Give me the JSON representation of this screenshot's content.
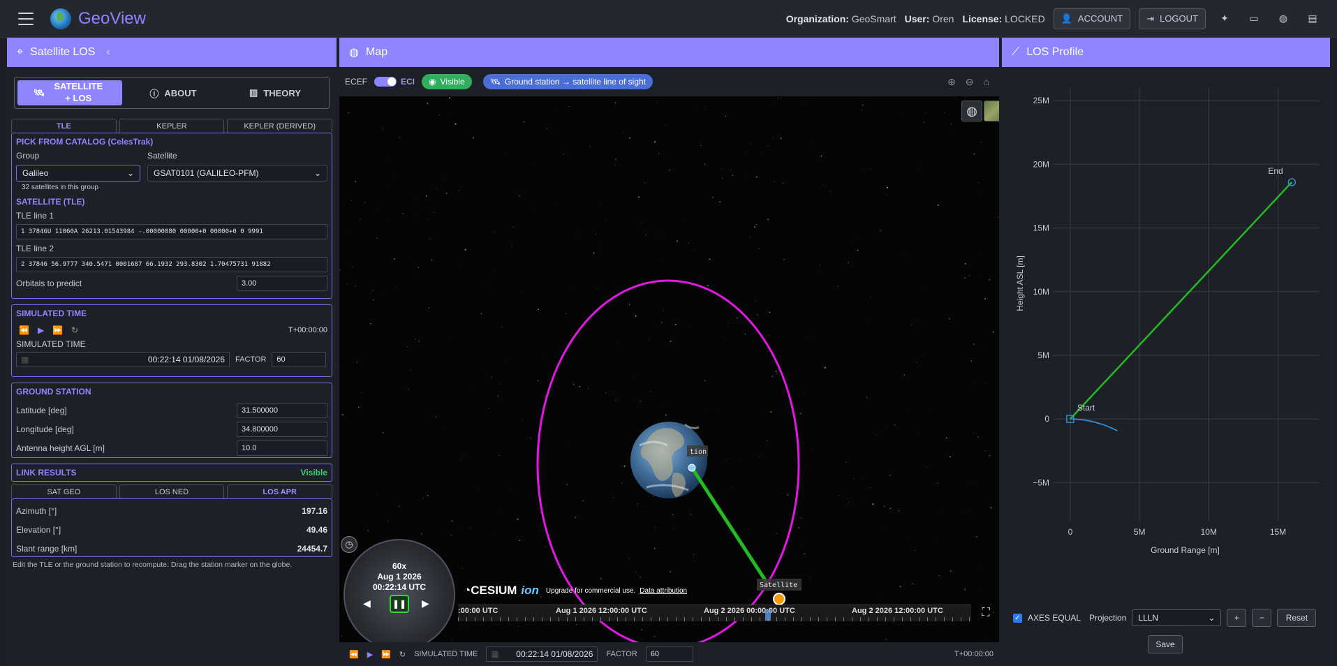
{
  "app": {
    "name": "GeoView",
    "organization_label": "Organization:",
    "organization": "GeoSmart",
    "user_label": "User:",
    "user": "Oren",
    "license_label": "License:",
    "license": "LOCKED",
    "account": "ACCOUNT",
    "logout": "LOGOUT"
  },
  "left": {
    "title": "Satellite LOS",
    "tabs": [
      {
        "label": "SATELLITE + LOS"
      },
      {
        "label": "ABOUT"
      },
      {
        "label": "THEORY"
      }
    ],
    "tle_tabs": [
      "TLE",
      "KEPLER",
      "KEPLER (DERIVED)"
    ],
    "catalog": {
      "title": "PICK FROM CATALOG (CelesTrak)",
      "group_label": "Group",
      "group": "Galileo",
      "satellite_label": "Satellite",
      "satellite": "GSAT0101 (GALILEO-PFM)",
      "group_count": "32 satellites in this group"
    },
    "tle": {
      "title": "SATELLITE (TLE)",
      "line1_label": "TLE line 1",
      "line1": "1 37846U 11060A   26213.01543984 -.00000080  00000+0  00000+0 0  9991",
      "line2_label": "TLE line 2",
      "line2": "2 37846  56.9777 340.5471 0001687  66.1932 293.8302  1.70475731 91882",
      "orbitals_label": "Orbitals to predict",
      "orbitals": "3.00"
    },
    "sim": {
      "title": "SIMULATED TIME",
      "offset": "T+00:00:00",
      "time_label": "SIMULATED TIME",
      "time": "00:22:14 01/08/2026",
      "factor_label": "FACTOR",
      "factor": "60"
    },
    "ground": {
      "title": "GROUND STATION",
      "lat_label": "Latitude [deg]",
      "lat": "31.500000",
      "lon_label": "Longitude [deg]",
      "lon": "34.800000",
      "ant_label": "Antenna height AGL [m]",
      "ant": "10.0"
    },
    "link": {
      "title": "LINK RESULTS",
      "status": "Visible",
      "tabs": [
        "SAT GEO",
        "LOS NED",
        "LOS APR"
      ],
      "az_label": "Azimuth [°]",
      "az": "197.16",
      "el_label": "Elevation [°]",
      "el": "49.46",
      "range_label": "Slant range [km]",
      "range": "24454.7"
    },
    "hint": "Edit the TLE or the ground station to recompute. Drag the station marker on the globe."
  },
  "map": {
    "title": "Map",
    "ecef": "ECEF",
    "eci": "ECI",
    "visible": "Visible",
    "los_chip": "Ground station → satellite line of sight",
    "station_label": "tion",
    "satellite_label": "Satellite",
    "clock": {
      "speed": "60x",
      "date": "Aug 1 2026",
      "time": "00:22:14 UTC"
    },
    "cesium": "CESIUM",
    "ion": "ion",
    "upgrade": "Upgrade for commercial use.",
    "attribution": "Data attribution",
    "timeline": [
      ":00:00 UTC",
      "Aug 1 2026 12:00:00 UTC",
      "Aug 2 2026 00:00:00 UTC",
      "Aug 2 2026 12:00:00 UTC"
    ],
    "bottom": {
      "sim_label": "SIMULATED TIME",
      "time": "00:22:14 01/08/2026",
      "factor_label": "FACTOR",
      "factor": "60",
      "offset": "T+00:00:00"
    },
    "colors": {
      "orbit": "#e317e3",
      "los": "#22bb22",
      "satellite": "#f59a10"
    }
  },
  "profile": {
    "title": "LOS Profile",
    "axes_equal": "AXES EQUAL",
    "projection_label": "Projection",
    "projection": "LLLN",
    "plus": "+",
    "minus": "−",
    "reset": "Reset",
    "save": "Save"
  },
  "chart_data": {
    "type": "line",
    "xlabel": "Ground Range [m]",
    "ylabel": "Height ASL [m]",
    "xlim": [
      -400000,
      18000000
    ],
    "ylim": [
      -8000000,
      26000000
    ],
    "xticks": [
      {
        "v": 0,
        "label": "0"
      },
      {
        "v": 5000000,
        "label": "5M"
      },
      {
        "v": 10000000,
        "label": "10M"
      },
      {
        "v": 15000000,
        "label": "15M"
      }
    ],
    "yticks": [
      {
        "v": -5000000,
        "label": "−5M"
      },
      {
        "v": 0,
        "label": "0"
      },
      {
        "v": 5000000,
        "label": "5M"
      },
      {
        "v": 10000000,
        "label": "10M"
      },
      {
        "v": 15000000,
        "label": "15M"
      },
      {
        "v": 20000000,
        "label": "20M"
      },
      {
        "v": 25000000,
        "label": "25M"
      }
    ],
    "series": [
      {
        "name": "",
        "color": "#22bb22",
        "x": [
          0,
          16000000
        ],
        "y": [
          0,
          18600000
        ]
      },
      {
        "name": "",
        "color": "#2f8fd6",
        "x": [
          0,
          500000,
          1000000,
          1500000,
          2000000,
          2500000,
          3000000,
          3400000
        ],
        "y": [
          0,
          -20000,
          -80000,
          -180000,
          -320000,
          -500000,
          -720000,
          -920000
        ]
      }
    ],
    "annotations": [
      {
        "text": "Start",
        "x": 0,
        "y": 0
      },
      {
        "text": "End",
        "x": 16000000,
        "y": 18600000
      }
    ]
  }
}
